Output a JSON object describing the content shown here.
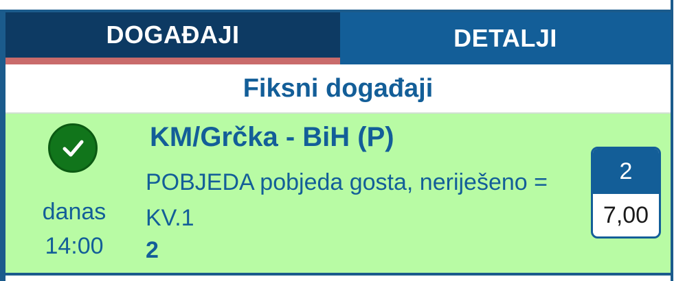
{
  "tabs": [
    {
      "label": "DOGAĐAJI",
      "active": true
    },
    {
      "label": "DETALJI",
      "active": false
    }
  ],
  "section": {
    "title": "Fiksni događaji"
  },
  "event": {
    "status_icon": "check-icon",
    "day": "danas",
    "time": "14:00",
    "title": "KM/Grčka - BiH (P)",
    "description": "POBJEDA pobjeda gosta, neriješeno = KV.1",
    "pick": "2",
    "odds": {
      "selection": "2",
      "value": "7,00"
    }
  },
  "colors": {
    "tab_active": "#0d3a63",
    "tab_inactive": "#135e98",
    "tab_indicator": "#c96b6b",
    "event_background": "#b8fba4",
    "status_success": "#11751b",
    "text_primary": "#135e98"
  }
}
